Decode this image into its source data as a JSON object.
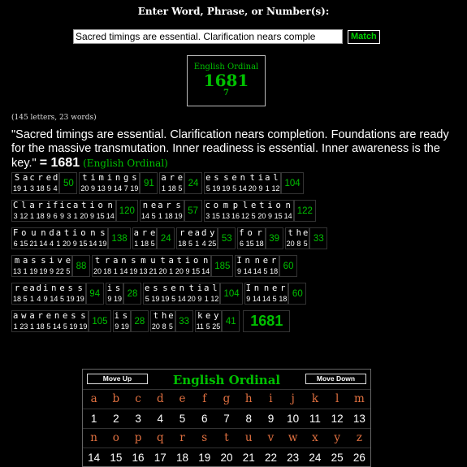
{
  "prompt": "Enter Word, Phrase, or Number(s):",
  "input": {
    "value": "Sacred timings are essential.  Clarification nears comple"
  },
  "match_label": "Match",
  "result": {
    "cipher": "English Ordinal",
    "value": "1681",
    "reduced": "7"
  },
  "stats": "(145 letters, 23 words)",
  "phrase": {
    "text": "\"Sacred timings are essential. Clarification nears completion. Foundations are ready for the massive transmutation. Inner readiness is essential. Inner awareness is the key.\"",
    "eq": "= 1681",
    "tag": "(English Ordinal)"
  },
  "breakdown_rows": [
    [
      {
        "letters": [
          "S",
          "a",
          "c",
          "r",
          "e",
          "d"
        ],
        "values": [
          "19",
          "1",
          "3",
          "18",
          "5",
          "4"
        ],
        "sum": "50"
      },
      {
        "letters": [
          "t",
          "i",
          "m",
          "i",
          "n",
          "g",
          "s"
        ],
        "values": [
          "20",
          "9",
          "13",
          "9",
          "14",
          "7",
          "19"
        ],
        "sum": "91"
      },
      {
        "letters": [
          "a",
          "r",
          "e"
        ],
        "values": [
          "1",
          "18",
          "5"
        ],
        "sum": "24"
      },
      {
        "letters": [
          "e",
          "s",
          "s",
          "e",
          "n",
          "t",
          "i",
          "a",
          "l"
        ],
        "values": [
          "5",
          "19",
          "19",
          "5",
          "14",
          "20",
          "9",
          "1",
          "12"
        ],
        "sum": "104"
      }
    ],
    [
      {
        "letters": [
          "C",
          "l",
          "a",
          "r",
          "i",
          "f",
          "i",
          "c",
          "a",
          "t",
          "i",
          "o",
          "n"
        ],
        "values": [
          "3",
          "12",
          "1",
          "18",
          "9",
          "6",
          "9",
          "3",
          "1",
          "20",
          "9",
          "15",
          "14"
        ],
        "sum": "120"
      },
      {
        "letters": [
          "n",
          "e",
          "a",
          "r",
          "s"
        ],
        "values": [
          "14",
          "5",
          "1",
          "18",
          "19"
        ],
        "sum": "57"
      },
      {
        "letters": [
          "c",
          "o",
          "m",
          "p",
          "l",
          "e",
          "t",
          "i",
          "o",
          "n"
        ],
        "values": [
          "3",
          "15",
          "13",
          "16",
          "12",
          "5",
          "20",
          "9",
          "15",
          "14"
        ],
        "sum": "122"
      }
    ],
    [
      {
        "letters": [
          "F",
          "o",
          "u",
          "n",
          "d",
          "a",
          "t",
          "i",
          "o",
          "n",
          "s"
        ],
        "values": [
          "6",
          "15",
          "21",
          "14",
          "4",
          "1",
          "20",
          "9",
          "15",
          "14",
          "19"
        ],
        "sum": "138"
      },
      {
        "letters": [
          "a",
          "r",
          "e"
        ],
        "values": [
          "1",
          "18",
          "5"
        ],
        "sum": "24"
      },
      {
        "letters": [
          "r",
          "e",
          "a",
          "d",
          "y"
        ],
        "values": [
          "18",
          "5",
          "1",
          "4",
          "25"
        ],
        "sum": "53"
      },
      {
        "letters": [
          "f",
          "o",
          "r"
        ],
        "values": [
          "6",
          "15",
          "18"
        ],
        "sum": "39"
      },
      {
        "letters": [
          "t",
          "h",
          "e"
        ],
        "values": [
          "20",
          "8",
          "5"
        ],
        "sum": "33"
      }
    ],
    [
      {
        "letters": [
          "m",
          "a",
          "s",
          "s",
          "i",
          "v",
          "e"
        ],
        "values": [
          "13",
          "1",
          "19",
          "19",
          "9",
          "22",
          "5"
        ],
        "sum": "88"
      },
      {
        "letters": [
          "t",
          "r",
          "a",
          "n",
          "s",
          "m",
          "u",
          "t",
          "a",
          "t",
          "i",
          "o",
          "n"
        ],
        "values": [
          "20",
          "18",
          "1",
          "14",
          "19",
          "13",
          "21",
          "20",
          "1",
          "20",
          "9",
          "15",
          "14"
        ],
        "sum": "185"
      },
      {
        "letters": [
          "I",
          "n",
          "n",
          "e",
          "r"
        ],
        "values": [
          "9",
          "14",
          "14",
          "5",
          "18"
        ],
        "sum": "60"
      }
    ],
    [
      {
        "letters": [
          "r",
          "e",
          "a",
          "d",
          "i",
          "n",
          "e",
          "s",
          "s"
        ],
        "values": [
          "18",
          "5",
          "1",
          "4",
          "9",
          "14",
          "5",
          "19",
          "19"
        ],
        "sum": "94"
      },
      {
        "letters": [
          "i",
          "s"
        ],
        "values": [
          "9",
          "19"
        ],
        "sum": "28"
      },
      {
        "letters": [
          "e",
          "s",
          "s",
          "e",
          "n",
          "t",
          "i",
          "a",
          "l"
        ],
        "values": [
          "5",
          "19",
          "19",
          "5",
          "14",
          "20",
          "9",
          "1",
          "12"
        ],
        "sum": "104"
      },
      {
        "letters": [
          "I",
          "n",
          "n",
          "e",
          "r"
        ],
        "values": [
          "9",
          "14",
          "14",
          "5",
          "18"
        ],
        "sum": "60"
      }
    ],
    [
      {
        "letters": [
          "a",
          "w",
          "a",
          "r",
          "e",
          "n",
          "e",
          "s",
          "s"
        ],
        "values": [
          "1",
          "23",
          "1",
          "18",
          "5",
          "14",
          "5",
          "19",
          "19"
        ],
        "sum": "105"
      },
      {
        "letters": [
          "i",
          "s"
        ],
        "values": [
          "9",
          "19"
        ],
        "sum": "28"
      },
      {
        "letters": [
          "t",
          "h",
          "e"
        ],
        "values": [
          "20",
          "8",
          "5"
        ],
        "sum": "33"
      },
      {
        "letters": [
          "k",
          "e",
          "y"
        ],
        "values": [
          "11",
          "5",
          "25"
        ],
        "sum": "41"
      }
    ]
  ],
  "grand_total": "1681",
  "cipher_table": {
    "title": "English Ordinal",
    "move_up": "Move Up",
    "move_down": "Move Down",
    "row1_letters": [
      "a",
      "b",
      "c",
      "d",
      "e",
      "f",
      "g",
      "h",
      "i",
      "j",
      "k",
      "l",
      "m"
    ],
    "row1_values": [
      "1",
      "2",
      "3",
      "4",
      "5",
      "6",
      "7",
      "8",
      "9",
      "10",
      "11",
      "12",
      "13"
    ],
    "row2_letters": [
      "n",
      "o",
      "p",
      "q",
      "r",
      "s",
      "t",
      "u",
      "v",
      "w",
      "x",
      "y",
      "z"
    ],
    "row2_values": [
      "14",
      "15",
      "16",
      "17",
      "18",
      "19",
      "20",
      "21",
      "22",
      "23",
      "24",
      "25",
      "26"
    ]
  },
  "colors": {
    "accent": "#00c000",
    "cipher_letter": "#e07040",
    "background": "#000000"
  }
}
